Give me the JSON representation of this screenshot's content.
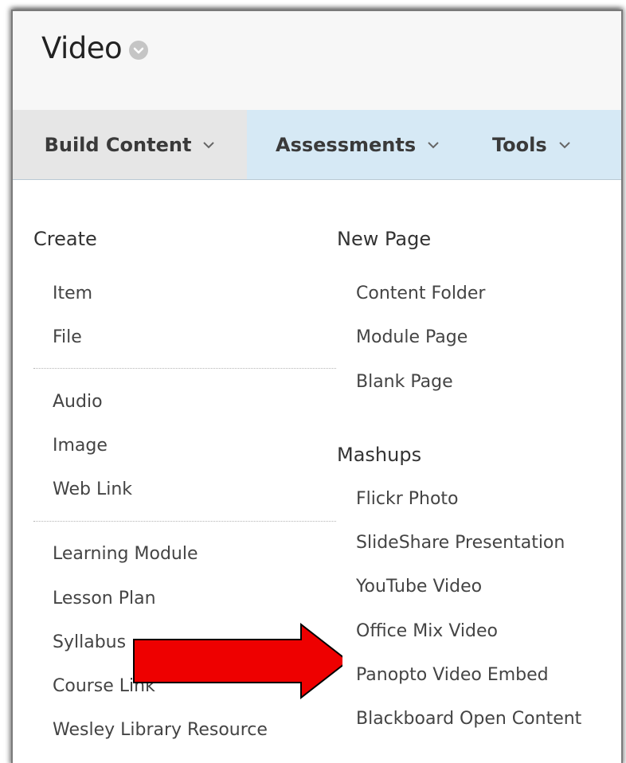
{
  "page": {
    "title": "Video"
  },
  "tabs": [
    {
      "label": "Build Content"
    },
    {
      "label": "Assessments"
    },
    {
      "label": "Tools"
    }
  ],
  "menu": {
    "left": {
      "header": "Create",
      "groups": [
        [
          "Item",
          "File"
        ],
        [
          "Audio",
          "Image",
          "Web Link"
        ],
        [
          "Learning Module",
          "Lesson Plan",
          "Syllabus",
          "Course Link",
          "Wesley Library Resource"
        ]
      ]
    },
    "right": {
      "new_page_header": "New Page",
      "new_page_items": [
        "Content Folder",
        "Module Page",
        "Blank Page"
      ],
      "mashups_header": "Mashups",
      "mashups_items": [
        "Flickr Photo",
        "SlideShare Presentation",
        "YouTube Video",
        "Office Mix Video",
        "Panopto Video Embed",
        "Blackboard Open Content"
      ]
    }
  },
  "icons": {
    "title_menu": "chevron-circle-icon",
    "dropdown": "chevron-down-icon",
    "pointer": "red-arrow-annotation"
  },
  "colors": {
    "action_bar": "#d6e9f5",
    "active_tab": "#e6e6e6",
    "arrow_fill": "#ee0000"
  }
}
